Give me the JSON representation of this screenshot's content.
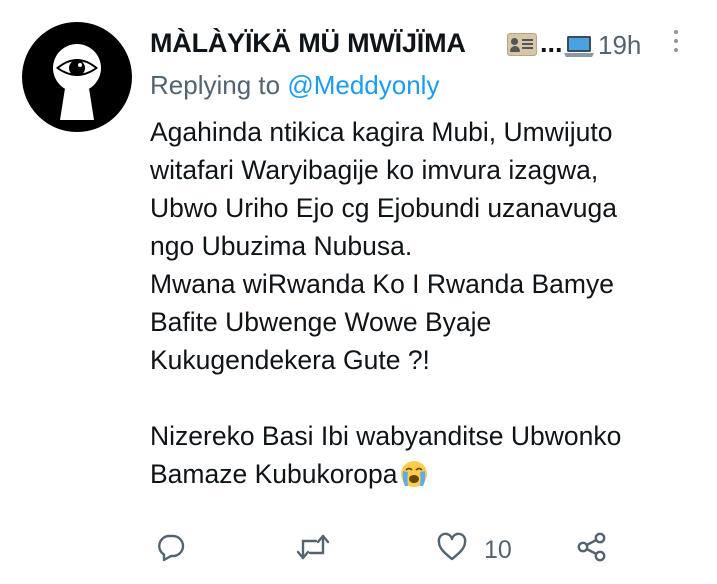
{
  "tweet": {
    "author": {
      "display_name": "MÀLÀYÏKÄ MÜ MWÏJÏMA",
      "ellipsis": "...",
      "badges": [
        "id-card-icon",
        "laptop-icon"
      ]
    },
    "timestamp": "19h",
    "reply_prefix": "Replying to",
    "reply_to": "@Meddyonly",
    "text_lines": [
      "Agahinda ntikica kagira Mubi, Umwijuto",
      "witafari Waryibagije ko imvura izagwa,",
      "Ubwo Uriho Ejo cg Ejobundi uzanavuga",
      "ngo Ubuzima Nubusa.",
      "Mwana wiRwanda Ko I Rwanda Bamye",
      "Bafite Ubwenge Wowe Byaje",
      "Kukugendekera Gute ?!",
      "",
      "Nizereko Basi Ibi wabyanditse Ubwonko",
      "Bamaze Kubukoropa"
    ],
    "trailing_emoji": "loudly-crying-face-emoji",
    "actions": {
      "reply_icon": "reply-icon",
      "retweet_icon": "retweet-icon",
      "like_icon": "heart-icon",
      "like_count": "10",
      "share_icon": "share-icon"
    }
  },
  "colors": {
    "text": "#0f1419",
    "secondary": "#536471",
    "link": "#1d9bf0",
    "avatar_bg": "#000000"
  }
}
